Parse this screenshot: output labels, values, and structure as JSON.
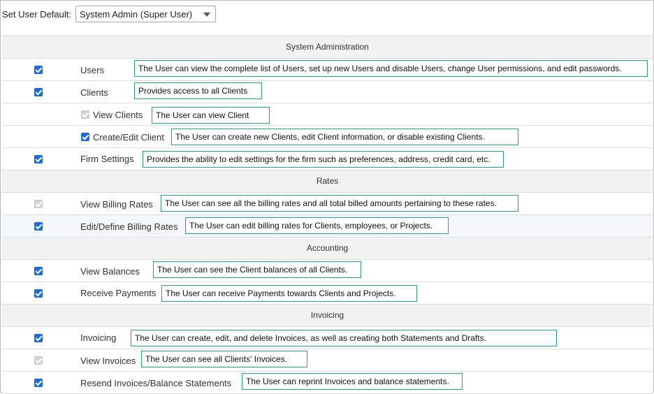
{
  "header": {
    "set_default_label": "Set User Default:",
    "role_select_value": "System Admin (Super User)"
  },
  "sections": {
    "system_admin": "System Administration",
    "rates": "Rates",
    "accounting": "Accounting",
    "invoicing": "Invoicing"
  },
  "permissions": {
    "users": {
      "label": "Users",
      "checked": true,
      "desc": "The User can view the complete list of Users, set up new Users and disable Users, change User permissions, and edit passwords."
    },
    "clients": {
      "label": "Clients",
      "checked": true,
      "desc": "Provides access to all Clients"
    },
    "view_clients": {
      "label": "View Clients",
      "checked": true,
      "disabled": true,
      "desc": "The User can view Client"
    },
    "create_edit_client": {
      "label": "Create/Edit Client",
      "checked": true,
      "desc": "The User can create new Clients, edit Client information, or disable existing Clients."
    },
    "firm_settings": {
      "label": "Firm Settings",
      "checked": true,
      "desc": "Provides the ability to edit settings for the firm such as preferences, address, credit card, etc."
    },
    "view_billing_rates": {
      "label": "View Billing Rates",
      "checked": true,
      "disabled": true,
      "desc": "The User can see all the billing rates and all total billed amounts pertaining to these rates."
    },
    "edit_billing_rates": {
      "label": "Edit/Define Billing Rates",
      "checked": true,
      "desc": "The User can edit billing rates for Clients, employees, or Projects."
    },
    "view_balances": {
      "label": "View Balances",
      "checked": true,
      "desc": "The User can see the Client balances of all Clients."
    },
    "receive_payments": {
      "label": "Receive Payments",
      "checked": true,
      "desc": "The User can receive Payments towards Clients and Projects."
    },
    "invoicing": {
      "label": "Invoicing",
      "checked": true,
      "desc": "The User can create, edit, and delete Invoices, as well as creating both Statements and Drafts."
    },
    "view_invoices": {
      "label": "View Invoices",
      "checked": true,
      "disabled": true,
      "desc": "The User can see all Clients' Invoices."
    },
    "resend_invoices": {
      "label": "Resend Invoices/Balance Statements",
      "checked": true,
      "desc": "The User can reprint Invoices and balance statements."
    }
  },
  "colors": {
    "checkbox_checked": "#1d6fd1",
    "checkbox_disabled": "#d3d3d3",
    "annotation_border": "#2a9d8f"
  }
}
